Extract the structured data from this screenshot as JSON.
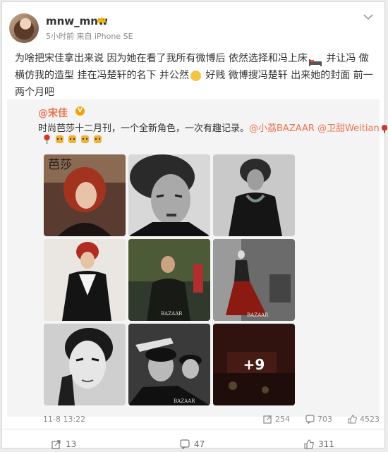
{
  "post": {
    "username": "mnw_mnw",
    "meta": "5小时前 来自 iPhone SE",
    "text_before_bed": "为啥把宋佳拿出来说 因为她在看了我所有微博后 依然选择和冯上床",
    "text_after_bed": " 并让冯 做横仿我的造型 挂在冯楚轩的名下 并公然",
    "text_after_emoji": " 好贱 微博搜冯楚轩 出来她的封面 前一两个月吧"
  },
  "repost": {
    "username": "@宋佳",
    "text": "时尚芭莎十二月刊，一个全新角色，一次有趣记录。",
    "mention1": "@小荔BAZAAR",
    "mention2": "@卫甜Weitian",
    "more_count": "+9",
    "time": "11-8 13:22",
    "reposts": "254",
    "comments": "703",
    "likes": "4523"
  },
  "actions": {
    "repost_count": "13",
    "comment_count": "47",
    "like_count": "311"
  },
  "magazine": {
    "cover_text": "芭莎",
    "brand": "BAZAAR"
  },
  "colors": {
    "accent": "#eb7350",
    "verified": "#f0a30a",
    "repost_bg": "#f4f4f4"
  }
}
